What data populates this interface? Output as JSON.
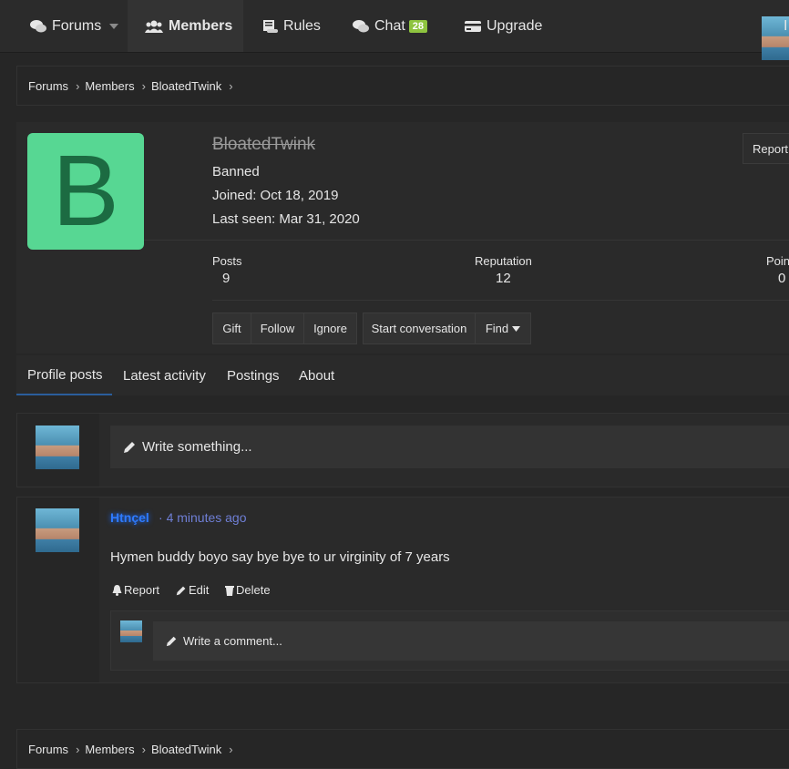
{
  "nav": {
    "forums": "Forums",
    "members": "Members",
    "rules": "Rules",
    "chat": "Chat",
    "chat_badge": "28",
    "upgrade": "Upgrade",
    "user_initial": "I"
  },
  "breadcrumb": [
    "Forums",
    "Members",
    "BloatedTwink"
  ],
  "profile": {
    "avatar_letter": "B",
    "avatar_color": "#57d793",
    "username": "BloatedTwink",
    "status": "Banned",
    "joined_label": "Joined:",
    "joined": "Oct 18, 2019",
    "last_seen_label": "Last seen:",
    "last_seen": "Mar 31, 2020",
    "report": "Report",
    "stats": [
      {
        "label": "Posts",
        "value": "9"
      },
      {
        "label": "Reputation",
        "value": "12"
      },
      {
        "label": "Poin",
        "value": "0"
      }
    ],
    "buttons": {
      "gift": "Gift",
      "follow": "Follow",
      "ignore": "Ignore",
      "start": "Start conversation",
      "find": "Find"
    }
  },
  "tabs": [
    "Profile posts",
    "Latest activity",
    "Postings",
    "About"
  ],
  "write_placeholder": "Write something...",
  "post": {
    "author": "Htnçel",
    "separator": "·",
    "time": "4 minutes ago",
    "text": "Hymen buddy boyo say bye bye to ur virginity of 7 years",
    "actions": {
      "report": "Report",
      "edit": "Edit",
      "delete": "Delete"
    },
    "comment_placeholder": "Write a comment..."
  },
  "footer_breadcrumb": [
    "Forums",
    "Members",
    "BloatedTwink"
  ]
}
